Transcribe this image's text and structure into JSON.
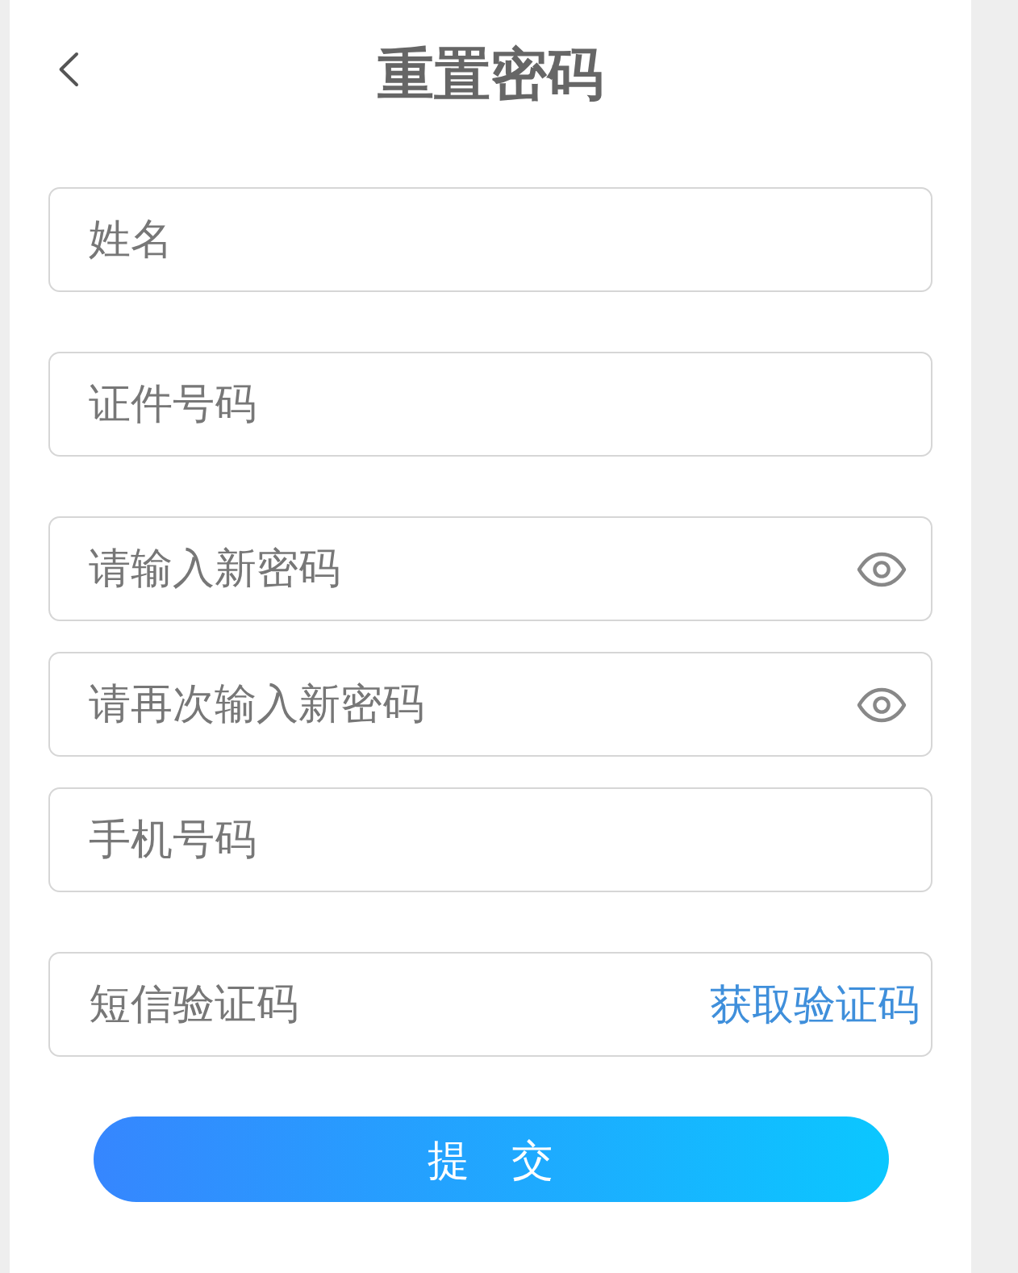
{
  "header": {
    "title": "重置密码"
  },
  "fields": [
    {
      "kind": "text",
      "placeholder": "姓名"
    },
    {
      "kind": "text",
      "placeholder": "证件号码"
    },
    {
      "kind": "password",
      "placeholder": "请输入新密码"
    },
    {
      "kind": "password",
      "placeholder": "请再次输入新密码"
    },
    {
      "kind": "text",
      "placeholder": "手机号码"
    },
    {
      "kind": "code",
      "placeholder": "短信验证码",
      "action_label": "获取验证码"
    }
  ],
  "submit": {
    "label": "提　交"
  }
}
